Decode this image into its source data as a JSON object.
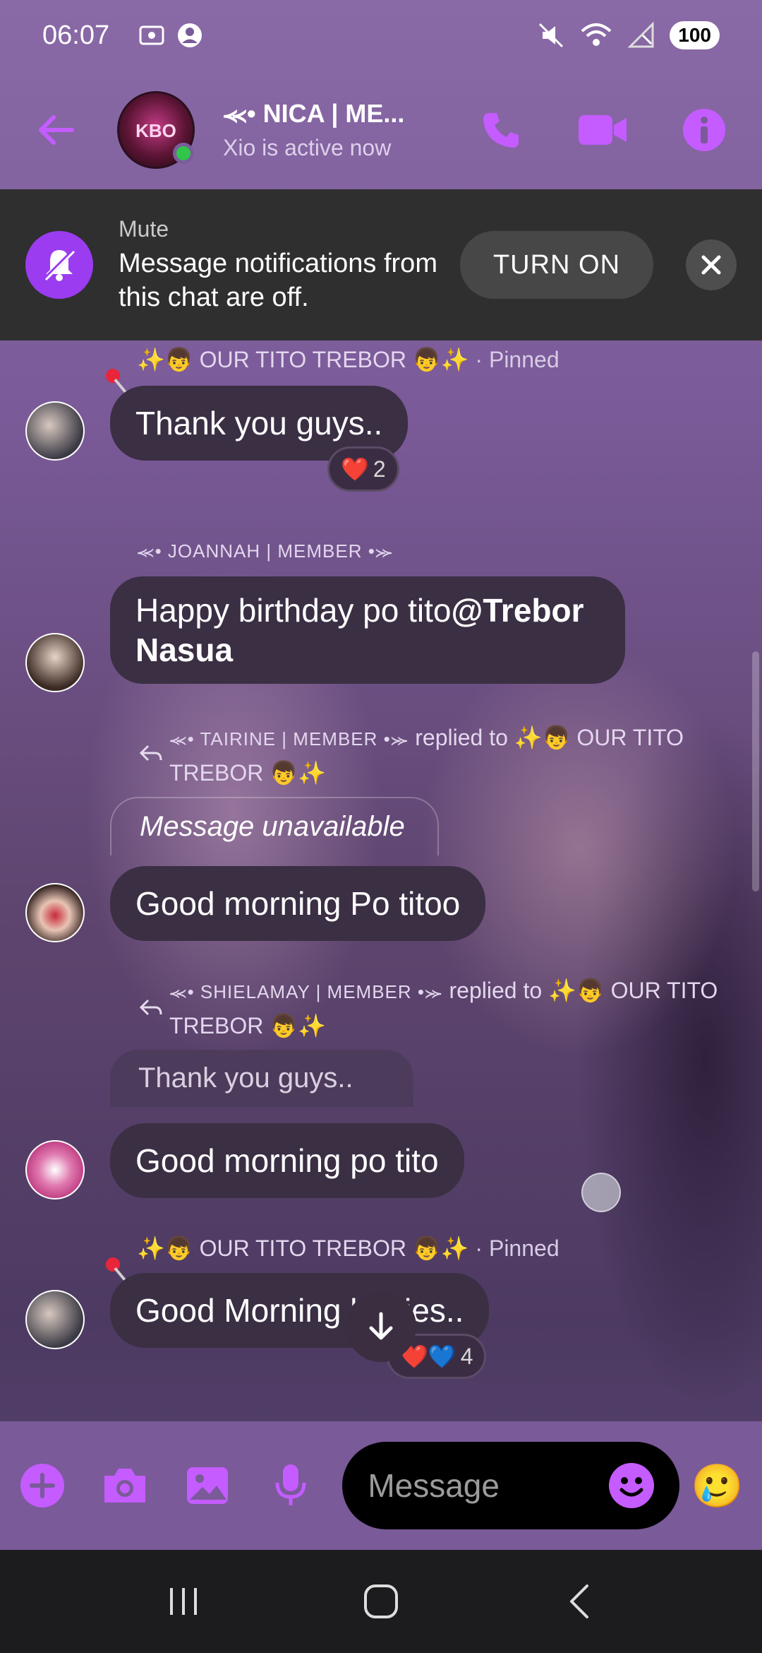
{
  "status_bar": {
    "time": "06:07",
    "battery": "100"
  },
  "header": {
    "title": "⪻• NICA | ME...",
    "subtitle": "Xio is active now",
    "avatar_text": "KBO"
  },
  "banner": {
    "label": "Mute",
    "message": "Message notifications from this chat are off.",
    "action": "TURN ON"
  },
  "messages": [
    {
      "sender": "✨👦 OUR TITO TREBOR 👦✨",
      "pinned": "· Pinned",
      "text": "Thank you guys..",
      "reaction_emoji": "❤️",
      "reaction_count": "2"
    },
    {
      "sender": "⪻• JOANNAH | MEMBER •⪼",
      "text_plain": "Happy birthday po tito",
      "mention": "@Trebor Nasua"
    },
    {
      "reply_sender": "⪻• TAIRINE | MEMBER •⪼",
      "reply_text": "replied to ✨👦 OUR TITO TREBOR 👦✨",
      "quoted": "Message unavailable",
      "text": "Good morning Po titoo"
    },
    {
      "reply_sender": "⪻• SHIELAMAY | MEMBER •⪼",
      "reply_text": "replied to ✨👦 OUR TITO TREBOR 👦✨",
      "quoted": "Thank you guys..",
      "text": "Good morning po tito"
    },
    {
      "sender": "✨👦 OUR TITO TREBOR 👦✨",
      "pinned": "· Pinned",
      "text": "Good Morning babies..",
      "reaction_emoji": "❤️💙",
      "reaction_count": "4"
    }
  ],
  "composer": {
    "placeholder": "Message",
    "quick_reaction": "🥲"
  },
  "colors": {
    "accent": "#c45cff",
    "bubble": "#3b2f44",
    "banner": "#2f2f2f"
  }
}
